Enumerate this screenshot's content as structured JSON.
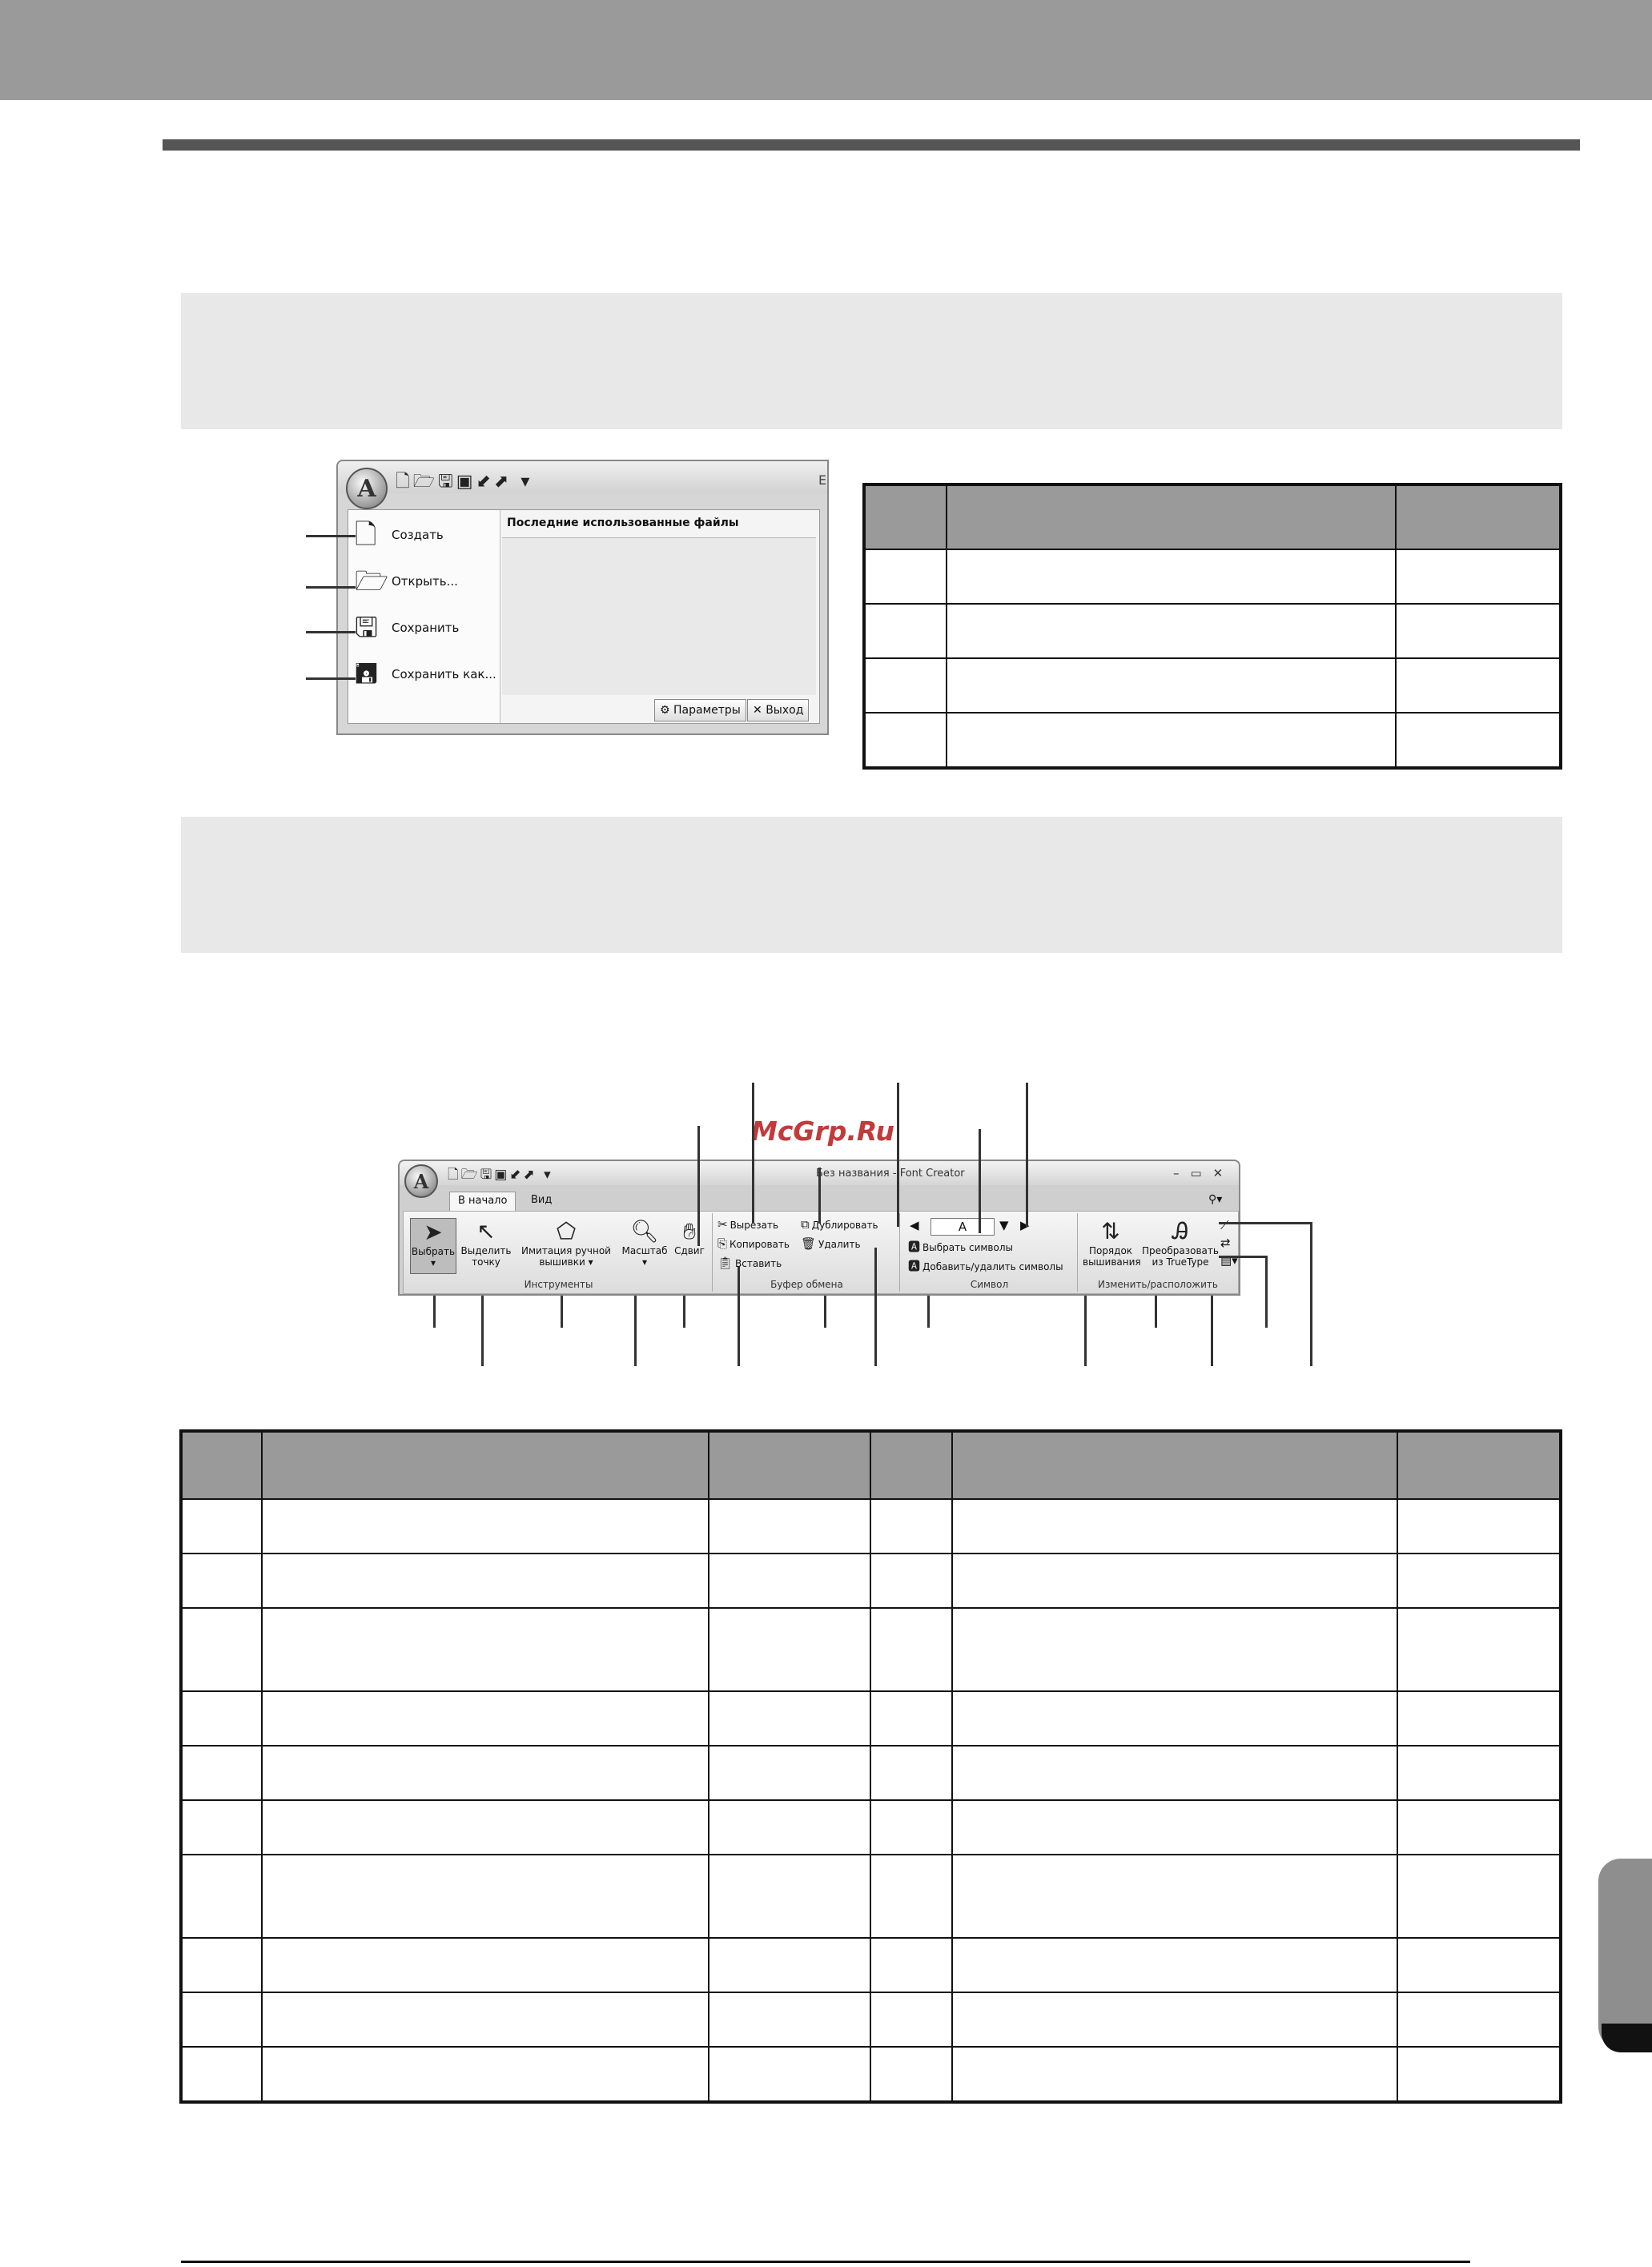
{
  "app_menu": {
    "items": [
      {
        "label": "Создать",
        "icon": "new-document-icon"
      },
      {
        "label": "Открыть...",
        "icon": "open-folder-icon"
      },
      {
        "label": "Сохранить",
        "icon": "save-disk-icon"
      },
      {
        "label": "Сохранить как...",
        "icon": "save-as-disk-icon"
      }
    ],
    "recent_files_title": "Последние использованные файлы",
    "params_button": "Параметры",
    "exit_button": "Выход",
    "app_button_letter": "A",
    "title_tail": "E"
  },
  "ribbon": {
    "app_button_letter": "A",
    "window_title": "Без названия - Font Creator",
    "tabs": [
      "В начало",
      "Вид"
    ],
    "groups": {
      "tools": {
        "label": "Инструменты",
        "select": "Выбрать",
        "select_point": "Выделить точку",
        "hand_stitch": "Имитация ручной вышивки",
        "zoom": "Масштаб",
        "pan": "Сдвиг"
      },
      "clipboard": {
        "label": "Буфер обмена",
        "cut": "Вырезать",
        "duplicate": "Дублировать",
        "copy": "Копировать",
        "delete": "Удалить",
        "paste": "Вставить"
      },
      "symbol": {
        "label": "Символ",
        "current": "A",
        "choose": "Выбрать символы",
        "add_remove": "Добавить/удалить символы"
      },
      "modify": {
        "label": "Изменить/расположить",
        "order": "Порядок вышивания",
        "convert": "Преобразовать из TrueType"
      }
    }
  },
  "watermark": "McGrp.Ru"
}
